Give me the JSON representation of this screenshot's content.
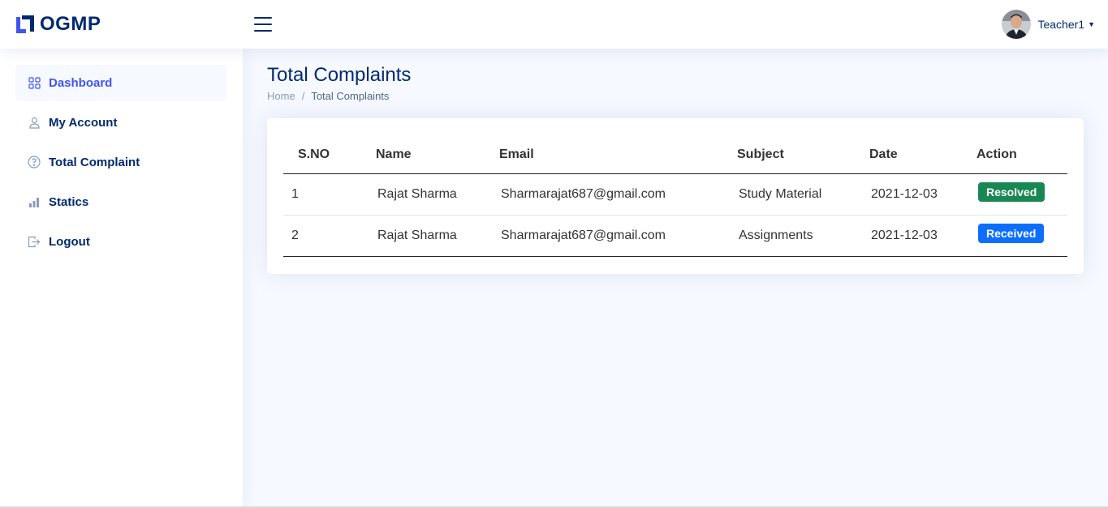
{
  "header": {
    "logo_text": "OGMP",
    "user_name": "Teacher1"
  },
  "sidebar": {
    "items": [
      {
        "label": "Dashboard",
        "icon": "grid-icon"
      },
      {
        "label": "My Account",
        "icon": "person-icon"
      },
      {
        "label": "Total Complaint",
        "icon": "question-circle-icon"
      },
      {
        "label": "Statics",
        "icon": "bar-chart-icon"
      },
      {
        "label": "Logout",
        "icon": "box-arrow-right-icon"
      }
    ]
  },
  "page": {
    "title": "Total Complaints",
    "breadcrumb": {
      "home": "Home",
      "separator": "/",
      "current": "Total Complaints"
    }
  },
  "table": {
    "headers": [
      "S.NO",
      "Name",
      "Email",
      "Subject",
      "Date",
      "Action"
    ],
    "rows": [
      {
        "sno": "1",
        "name": "Rajat Sharma",
        "email": "Sharmarajat687@gmail.com",
        "subject": "Study Material",
        "date": "2021-12-03",
        "action": "Resolved",
        "action_color": "#198754"
      },
      {
        "sno": "2",
        "name": "Rajat Sharma",
        "email": "Sharmarajat687@gmail.com",
        "subject": "Assignments",
        "date": "2021-12-03",
        "action": "Received",
        "action_color": "#0d6efd"
      }
    ]
  },
  "colors": {
    "brand": "#012970",
    "accent": "#4154f1",
    "background": "#f6f9ff"
  }
}
